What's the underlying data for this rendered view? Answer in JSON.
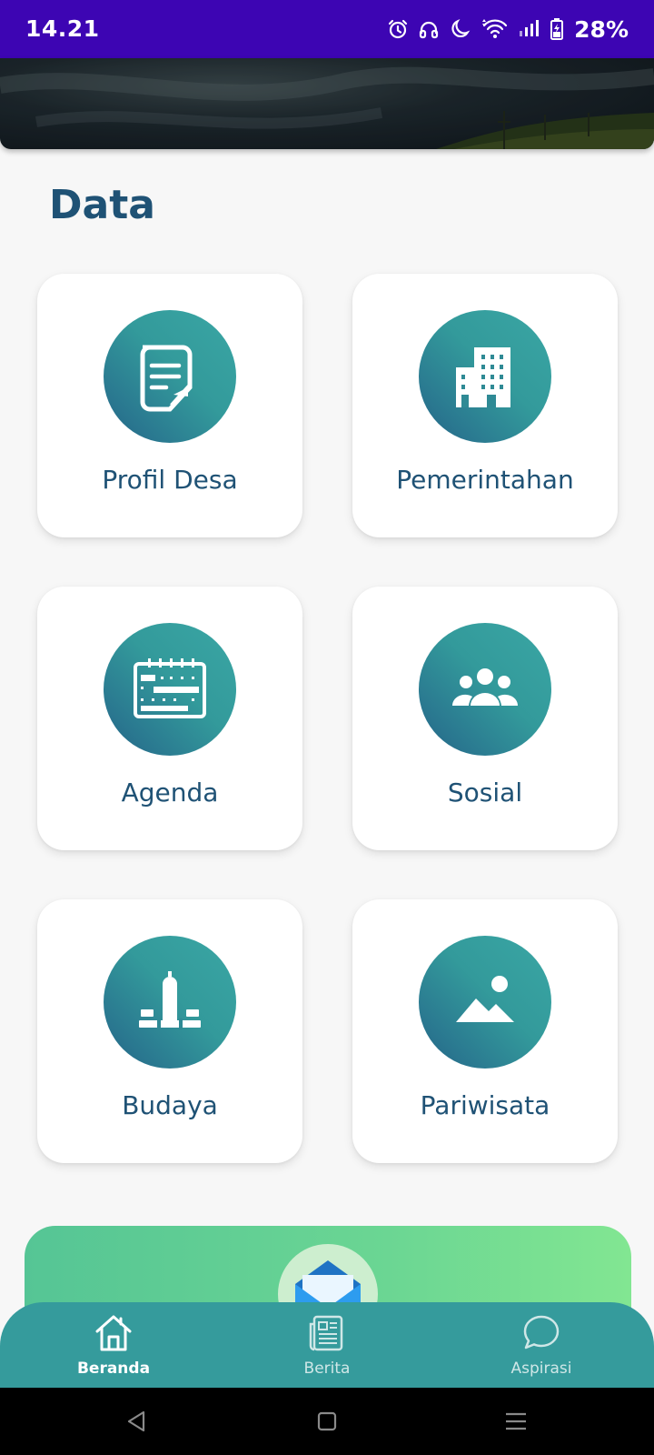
{
  "status_bar": {
    "time": "14.21",
    "battery": "28%",
    "icons": [
      "alarm-icon",
      "headphones-icon",
      "moon-icon",
      "wifi-icon",
      "signal-icon",
      "battery-icon"
    ]
  },
  "section": {
    "title": "Data"
  },
  "cards": [
    {
      "label": "Profil Desa",
      "icon": "document-icon"
    },
    {
      "label": "Pemerintahan",
      "icon": "building-icon"
    },
    {
      "label": "Agenda",
      "icon": "calendar-icon"
    },
    {
      "label": "Sosial",
      "icon": "people-icon"
    },
    {
      "label": "Budaya",
      "icon": "monument-icon"
    },
    {
      "label": "Pariwisata",
      "icon": "landscape-icon"
    }
  ],
  "bottom_nav": {
    "items": [
      {
        "label": "Beranda",
        "icon": "home-icon",
        "active": true
      },
      {
        "label": "Berita",
        "icon": "newspaper-icon",
        "active": false
      },
      {
        "label": "Aspirasi",
        "icon": "chat-icon",
        "active": false
      }
    ]
  },
  "colors": {
    "status_bar": "#3d05b3",
    "title": "#1f5275",
    "accent_teal": "#359b9c",
    "banner_green": "#6bd693"
  }
}
